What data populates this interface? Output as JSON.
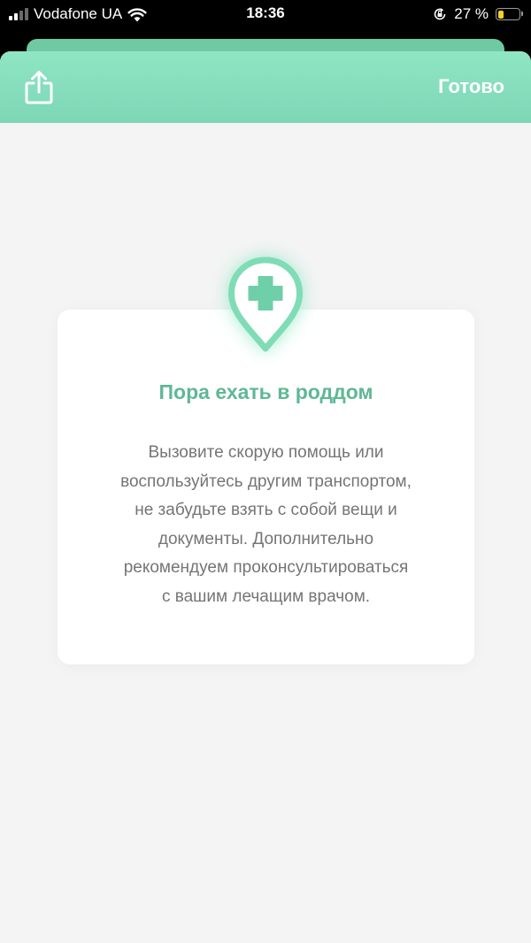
{
  "status_bar": {
    "carrier": "Vodafone UA",
    "time": "18:36",
    "battery_percent": "27 %",
    "battery_level": 0.27,
    "battery_color": "#f2cc2e",
    "icons": [
      "signal-icon",
      "wifi-icon",
      "orientation-lock-icon",
      "battery-icon"
    ]
  },
  "header": {
    "share_icon": "share-icon",
    "done_label": "Готово",
    "gradient_colors": [
      "#8fe6c3",
      "#7dd6b5"
    ]
  },
  "card": {
    "icon": "medical-location-pin-icon",
    "title": "Пора ехать в роддом",
    "text_lines": [
      "Вызовите скорую помощь или",
      "воспользуйтесь другим транспортом,",
      "не забудьте взять с собой вещи и",
      "документы. Дополнительно",
      "рекомендуем проконсультироваться",
      "с вашим лечащим врачом."
    ]
  },
  "colors": {
    "accent": "#5fb894",
    "pin": "#7fdcb6",
    "background": "#f4f4f4",
    "text": "#757575"
  }
}
